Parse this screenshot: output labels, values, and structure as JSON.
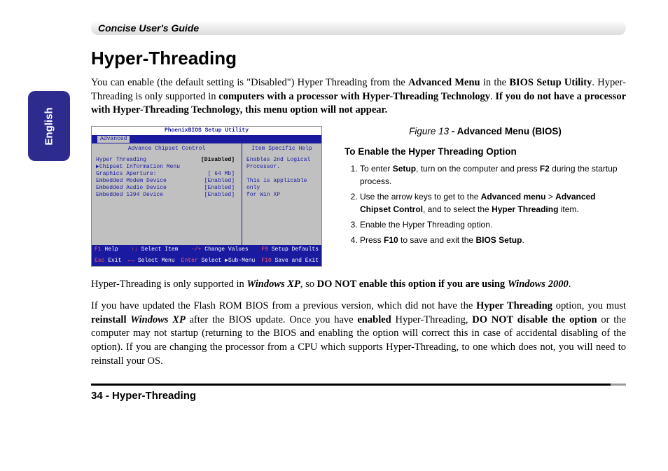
{
  "header": {
    "guide_title": "Concise User's Guide"
  },
  "side_tab": {
    "language": "English"
  },
  "title": "Hyper-Threading",
  "intro_html": "You can enable (the default setting is \"Disabled\") Hyper Threading from the <b>Advanced Menu</b> in the <b>BIOS Setup Utility</b>. Hyper-Threading is only supported in <b>computers with a processor with Hyper-Threading Technology</b>. <b>If you do not have a processor with Hyper-Threading Technology, this menu option will not appear.</b>",
  "bios": {
    "title": "PhoenixBIOS Setup Utility",
    "tab_active": "Advanced",
    "left_header": "Advance Chipset Control",
    "right_header": "Item Specific Help",
    "items": [
      {
        "label": "Hyper Threading",
        "value": "[Disabled]",
        "hl": true
      },
      {
        "label": "▶Chipset Information Menu",
        "value": ""
      },
      {
        "label": "",
        "value": ""
      },
      {
        "label": "Graphics Aperture:",
        "value": "[ 64 Mb]"
      },
      {
        "label": "",
        "value": ""
      },
      {
        "label": "Embedded Modem Device",
        "value": "[Enabled]"
      },
      {
        "label": "Embedded Audio Device",
        "value": "[Enabled]"
      },
      {
        "label": "Embedded 1394 Device",
        "value": "[Enabled]"
      }
    ],
    "help_lines": [
      "Enables 2nd Logical",
      "Processor.",
      "",
      "This is applicable only",
      "for Win XP"
    ],
    "footer": {
      "f1": "F1",
      "help": "Help",
      "updown": "↑↓",
      "select_item": "Select Item",
      "pm": "-/+",
      "change": "Change Values",
      "f9": "F9",
      "defaults": "Setup Defaults",
      "esc": "Esc",
      "exit": "Exit",
      "lr": "←→",
      "select_menu": "Select Menu",
      "enter": "Enter",
      "submenu": "Select ▶Sub-Menu",
      "f10": "F10",
      "save": "Save and Exit"
    }
  },
  "figure": {
    "num": "Figure 13",
    "caption": " - Advanced Menu (BIOS)"
  },
  "enable_heading": "To Enable the Hyper Threading Option",
  "steps": [
    "To enter <b>Setup</b>, turn on the computer and press <b>F2</b> during the startup process.",
    "Use the arrow keys to get to the <b>Advanced menu</b> > <b>Advanced Chipset Control</b>, and to select the <b>Hyper Threading</b> item.",
    "Enable the Hyper Threading option.",
    "Press <b>F10</b> to save and exit the <b>BIOS Setup</b>."
  ],
  "para2_html": "Hyper-Threading is only supported in <b><i>Windows XP</i></b>, so <b>DO NOT enable this option if you are using <i>Windows 2000</i></b>.",
  "para3_html": "If you have updated the Flash ROM BIOS from a previous version, which did not have the <b>Hyper Threading</b> option, you must <b>reinstall <i>Windows XP</i></b> after the BIOS update. Once you have <b>enabled</b> Hyper-Threading, <b>DO NOT disable the option</b> or the computer may not startup (returning to the BIOS and enabling the option will correct this in case of accidental disabling of the option). If you are changing the processor from a CPU which supports Hyper-Threading, to one which does not, you will need to reinstall your OS.",
  "footer": {
    "page": "34 -  Hyper-Threading"
  }
}
